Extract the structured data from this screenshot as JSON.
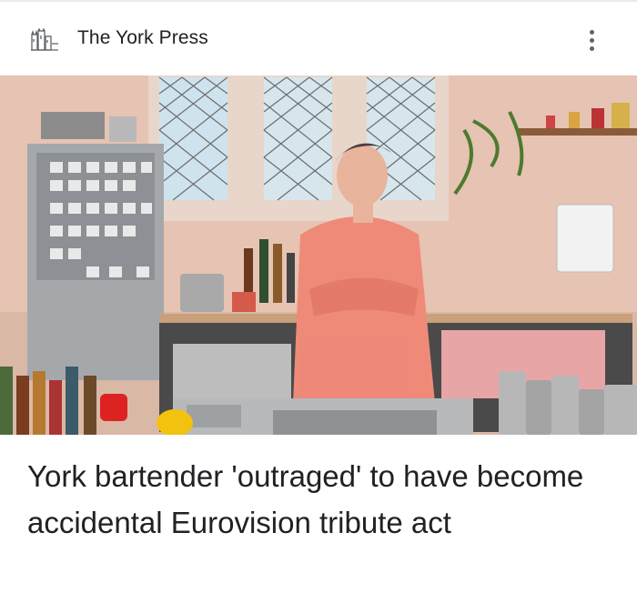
{
  "header": {
    "publisher_name": "The York Press",
    "logo_icon": "castle-logo-icon",
    "menu_icon": "more-vert-icon"
  },
  "article": {
    "image_description_icon": "article-photo",
    "headline": "York bartender 'outraged' to have become accidental Eurovision tribute act"
  },
  "colors": {
    "text": "#202124",
    "icon": "#5f6368",
    "background": "#ffffff"
  }
}
